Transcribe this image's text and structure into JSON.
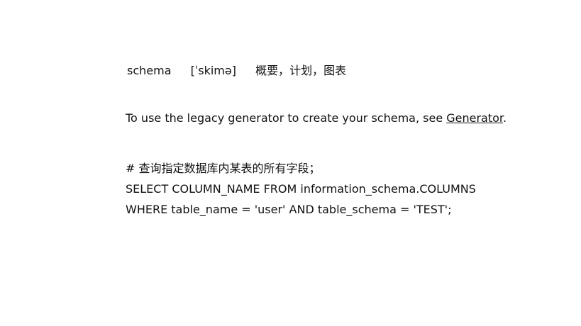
{
  "vocab": {
    "word": "schema",
    "phonetic": "[ˈskimə]",
    "meaning": "概要，计划，图表"
  },
  "sentence": {
    "prefix": "To use the legacy generator to create your schema, see ",
    "link_text": "Generator",
    "suffix": "."
  },
  "code": {
    "comment": "# 查询指定数据库内某表的所有字段；",
    "line1": "SELECT COLUMN_NAME FROM information_schema.COLUMNS",
    "line2": "WHERE table_name = 'user' AND table_schema = 'TEST';"
  }
}
